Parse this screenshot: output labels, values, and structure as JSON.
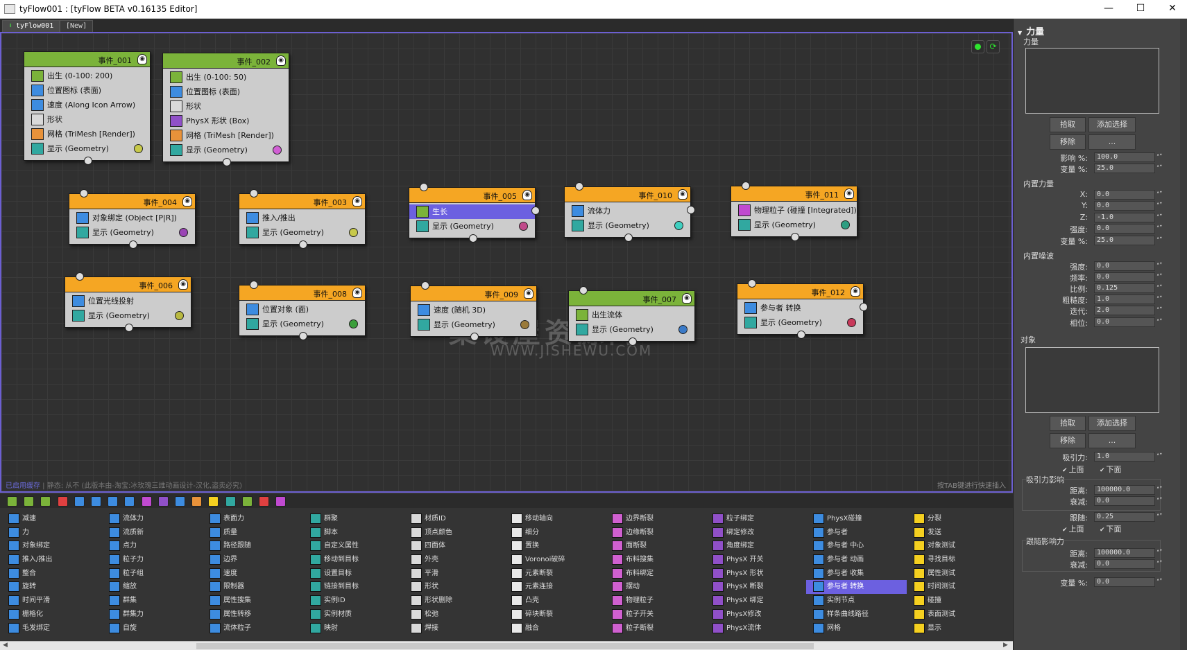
{
  "window": {
    "title": "tyFlow001 : [tyFlow BETA v0.16135 Editor]",
    "min": "—",
    "max": "☐",
    "close": "✕"
  },
  "tabs": [
    {
      "label": "tyFlow001"
    },
    {
      "label": "[New]"
    }
  ],
  "canvas": {
    "status_accent": "已启用缓存",
    "status_rest": " | 静态: 从不 (此版本由-淘宝:冰玫瑰三维动画设计-汉化,盗卖必究)",
    "hint": "按TAB键进行快速插入",
    "watermark": "集设屋资源网",
    "watermark_url": "WWW.JISHEWU.COM"
  },
  "events": [
    {
      "name": "事件_001",
      "header_color": "#7bb33a",
      "ops": [
        {
          "label": "出生 (0-100: 200)",
          "icon_color": "#7bb33a"
        },
        {
          "label": "位置图标 (表面)",
          "icon_color": "#3d8ce0"
        },
        {
          "label": "速度 (Along Icon Arrow)",
          "icon_color": "#3d8ce0"
        },
        {
          "label": "形状",
          "icon_color": "#d9d9d9"
        },
        {
          "label": "网格 (TriMesh [Render])",
          "icon_color": "#e8923a"
        },
        {
          "label": "显示 (Geometry)",
          "icon_color": "#31a8a0",
          "dot": "#c7c94a"
        }
      ]
    },
    {
      "name": "事件_002",
      "header_color": "#7bb33a",
      "ops": [
        {
          "label": "出生 (0-100: 50)",
          "icon_color": "#7bb33a"
        },
        {
          "label": "位置图标 (表面)",
          "icon_color": "#3d8ce0"
        },
        {
          "label": "形状",
          "icon_color": "#d9d9d9"
        },
        {
          "label": "PhysX 形状 (Box)",
          "icon_color": "#9050c8"
        },
        {
          "label": "网格 (TriMesh [Render])",
          "icon_color": "#e8923a"
        },
        {
          "label": "显示 (Geometry)",
          "icon_color": "#31a8a0",
          "dot": "#d15fd4"
        }
      ]
    },
    {
      "name": "事件_004",
      "header_color": "#f5a623",
      "ops": [
        {
          "label": "对象绑定 (Object [P|R])",
          "icon_color": "#3d8ce0"
        },
        {
          "label": "显示 (Geometry)",
          "icon_color": "#31a8a0",
          "dot": "#9a45b5"
        }
      ]
    },
    {
      "name": "事件_003",
      "header_color": "#f5a623",
      "ops": [
        {
          "label": "推入/推出",
          "icon_color": "#3d8ce0"
        },
        {
          "label": "显示 (Geometry)",
          "icon_color": "#31a8a0",
          "dot": "#c7c94a"
        }
      ]
    },
    {
      "name": "事件_005",
      "header_color": "#f5a623",
      "ops": [
        {
          "label": "生长",
          "icon_color": "#7bb33a",
          "selected": true
        },
        {
          "label": "显示 (Geometry)",
          "icon_color": "#31a8a0",
          "dot": "#c04a8a"
        }
      ]
    },
    {
      "name": "事件_010",
      "header_color": "#f5a623",
      "ops": [
        {
          "label": "流体力",
          "icon_color": "#3d8ce0"
        },
        {
          "label": "显示 (Geometry)",
          "icon_color": "#31a8a0",
          "dot": "#3fcfc0"
        }
      ]
    },
    {
      "name": "事件_011",
      "header_color": "#f5a623",
      "ops": [
        {
          "label": "物理粒子 (碰撞 [Integrated])",
          "icon_color": "#c04ad0"
        },
        {
          "label": "显示 (Geometry)",
          "icon_color": "#31a8a0",
          "dot": "#2e9e82"
        }
      ]
    },
    {
      "name": "事件_006",
      "header_color": "#f5a623",
      "ops": [
        {
          "label": "位置光线投射",
          "icon_color": "#3d8ce0"
        },
        {
          "label": "显示 (Geometry)",
          "icon_color": "#31a8a0",
          "dot": "#b8b840"
        }
      ]
    },
    {
      "name": "事件_008",
      "header_color": "#f5a623",
      "ops": [
        {
          "label": "位置对象 (面)",
          "icon_color": "#3d8ce0"
        },
        {
          "label": "显示 (Geometry)",
          "icon_color": "#31a8a0",
          "dot": "#3a9e3a"
        }
      ]
    },
    {
      "name": "事件_009",
      "header_color": "#f5a623",
      "ops": [
        {
          "label": "速度 (随机 3D)",
          "icon_color": "#3d8ce0"
        },
        {
          "label": "显示 (Geometry)",
          "icon_color": "#31a8a0",
          "dot": "#9a7a3a"
        }
      ]
    },
    {
      "name": "事件_007",
      "header_color": "#7bb33a",
      "ops": [
        {
          "label": "出生流体",
          "icon_color": "#7bb33a"
        },
        {
          "label": "显示 (Geometry)",
          "icon_color": "#31a8a0",
          "dot": "#3a7ac8"
        }
      ]
    },
    {
      "name": "事件_012",
      "header_color": "#f5a623",
      "ops": [
        {
          "label": "参与者 转换",
          "icon_color": "#3d8ce0"
        },
        {
          "label": "显示 (Geometry)",
          "icon_color": "#31a8a0",
          "dot": "#c8385a"
        }
      ]
    }
  ],
  "depot_icons": [
    "#7bb33a",
    "#7bb33a",
    "#7bb33a",
    "#e04040",
    "#3d8ce0",
    "#3d8ce0",
    "#3d8ce0",
    "#3d8ce0",
    "#c04ad0",
    "#9050c8",
    "#3d8ce0",
    "#e8923a",
    "#f5d020",
    "#31a8a0",
    "#7bb33a",
    "#e04040",
    "#c04ad0"
  ],
  "operator_columns": [
    {
      "color": "#3d8ce0",
      "items": [
        "减速",
        "力",
        "对象绑定",
        "推入/推出",
        "整合",
        "旋转",
        "时间平滑",
        "栅格化",
        "毛发绑定"
      ]
    },
    {
      "color": "#3d8ce0",
      "items": [
        "流体力",
        "流质新",
        "点力",
        "粒子力",
        "粒子组",
        "缩放",
        "群集",
        "群集力",
        "自旋"
      ]
    },
    {
      "color": "#3d8ce0",
      "items": [
        "表面力",
        "质量",
        "路径跟随",
        "边界",
        "速度",
        "限制器",
        "属性搜集",
        "属性转移",
        "流体粒子"
      ]
    },
    {
      "color": "#31a8a0",
      "items": [
        "群聚",
        "脚本",
        "自定义属性",
        "移动到目标",
        "设置目标",
        "链接到目标",
        "实例ID",
        "实例材质",
        "映射"
      ]
    },
    {
      "color": "#d9d9d9",
      "items": [
        "材质ID",
        "顶点颜色",
        "四面体",
        "外壳",
        "平滑",
        "形状",
        "形状删除",
        "松弛",
        "焊接"
      ]
    },
    {
      "color": "#e8e8e8",
      "items": [
        "移动轴向",
        "细分",
        "置换",
        "Voronoi破碎",
        "元素断裂",
        "元素连接",
        "凸壳",
        "碎块断裂",
        "融合"
      ]
    },
    {
      "color": "#d060d0",
      "items": [
        "边界断裂",
        "边缘断裂",
        "面断裂",
        "布料搜集",
        "布料绑定",
        "摆动",
        "物理粒子",
        "粒子开关",
        "粒子断裂"
      ]
    },
    {
      "color": "#9050c8",
      "items": [
        "粒子绑定",
        "绑定修改",
        "角度绑定",
        "PhysX 开关",
        "PhysX 形状",
        "PhysX 断裂",
        "PhysX 绑定",
        "PhysX修改",
        "PhysX流体"
      ]
    },
    {
      "color": "#3d8ce0",
      "items": [
        "PhysX碰撞",
        "参与者",
        "参与者 中心",
        "参与者 动画",
        "参与者 收集",
        "参与者 转换",
        "实例节点",
        "样条曲线路径",
        "网格"
      ],
      "highlight": 5
    },
    {
      "color": "#f5d020",
      "items": [
        "分裂",
        "发送",
        "对象测试",
        "寻找目标",
        "属性测试",
        "时间测试",
        "碰撞",
        "表面测试",
        "显示"
      ]
    }
  ],
  "panel": {
    "rollout_title": "力量",
    "forces_label": "力量",
    "pick": "拾取",
    "add_select": "添加选择",
    "remove": "移除",
    "dots": "...",
    "influence_label": "影响 %:",
    "influence": "100.0",
    "variation_label": "变量 %:",
    "variation": "25.0",
    "builtin_force": "内置力量",
    "x_label": "X:",
    "x": "0.0",
    "y_label": "Y:",
    "y": "0.0",
    "z_label": "Z:",
    "z": "-1.0",
    "strength_label": "强度:",
    "strength": "0.0",
    "bf_variation_label": "变量 %:",
    "bf_variation": "25.0",
    "builtin_noise": "内置噪波",
    "n_strength_label": "强度:",
    "n_strength": "0.0",
    "n_freq_label": "频率:",
    "n_freq": "0.0",
    "n_scale_label": "比例:",
    "n_scale": "0.125",
    "n_rough_label": "粗糙度:",
    "n_rough": "1.0",
    "n_iter_label": "迭代:",
    "n_iter": "2.0",
    "n_phase_label": "相位:",
    "n_phase": "0.0",
    "objects_label": "对象",
    "pick2": "拾取",
    "add_select2": "添加选择",
    "remove2": "移除",
    "dots2": "...",
    "attract_label": "吸引力:",
    "attract": "1.0",
    "above": "上面",
    "below": "下面",
    "attract_influence": "吸引力影响",
    "dist_label": "距离:",
    "dist": "100000.0",
    "falloff_label": "衰减:",
    "falloff": "0.0",
    "follow_label": "跟随:",
    "follow": "0.25",
    "above2": "上面",
    "below2": "下面",
    "follow_influence": "跟随影响力",
    "dist2_label": "距离:",
    "dist2": "100000.0",
    "falloff2_label": "衰减:",
    "falloff2": "0.0",
    "var2_label": "变量 %:",
    "var2": "0.0"
  }
}
